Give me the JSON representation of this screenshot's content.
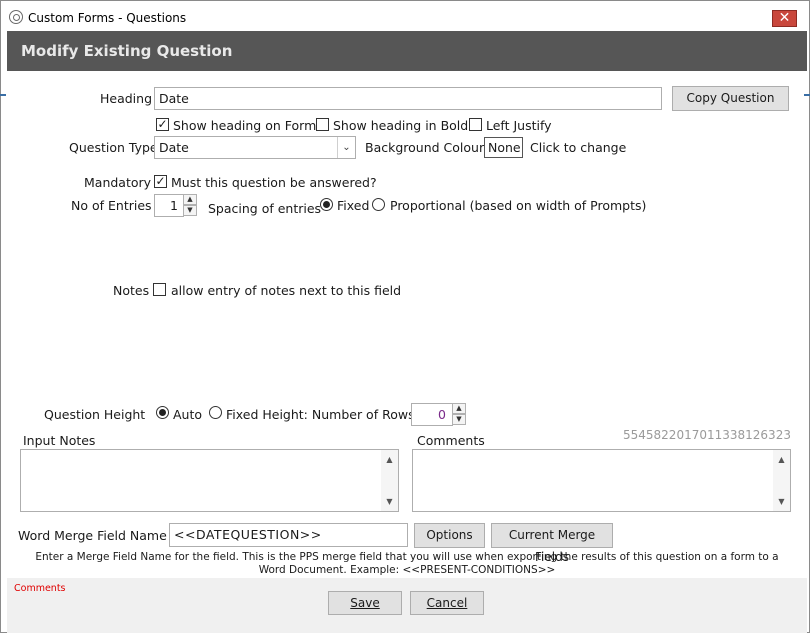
{
  "window": {
    "title": "Custom Forms - Questions",
    "close_glyph": "✕",
    "header": "Modify Existing Question"
  },
  "heading": {
    "label": "Heading",
    "value": "Date",
    "copy_button": "Copy Question",
    "show_on_form": {
      "label": "Show heading on Form",
      "checked": true
    },
    "show_bold": {
      "label": "Show heading in Bold",
      "checked": false
    },
    "left_justify": {
      "label": "Left Justify",
      "checked": false
    }
  },
  "question_type": {
    "label": "Question Type",
    "value": "Date",
    "bg_label": "Background Colour",
    "bg_value": "None",
    "bg_hint": "Click to change"
  },
  "mandatory": {
    "label": "Mandatory",
    "checkbox_label": "Must this question be answered?",
    "checked": true
  },
  "entries": {
    "label": "No of Entries",
    "value": "1",
    "spacing_label": "Spacing of entries",
    "fixed_label": "Fixed",
    "proportional_label": "Proportional (based on width of Prompts)",
    "selected": "Fixed"
  },
  "notes": {
    "label": "Notes",
    "checkbox_label": "allow entry of notes next to this field",
    "checked": false
  },
  "question_height": {
    "label": "Question Height",
    "auto_label": "Auto",
    "fixed_label": "Fixed Height: Number of Rows",
    "selected": "Auto",
    "rows_value": "0"
  },
  "input_notes": {
    "label": "Input Notes",
    "value": ""
  },
  "comments": {
    "label": "Comments",
    "value": "",
    "id_text": "5545822017011338126323"
  },
  "merge": {
    "label": "Word Merge Field Name",
    "value": "<<DATEQUESTION>>",
    "options_button": "Options",
    "current_button": "Current Merge Fields",
    "help": "Enter a Merge Field Name for the field. This is the PPS merge field that you will use when exporting the results of this question on a form to a Word Document. Example: <<PRESENT-CONDITIONS>>"
  },
  "footer": {
    "comments_link": "Comments",
    "save_label": "Save",
    "cancel_label": "Cancel"
  },
  "colors": {
    "header_band": "#565656",
    "close_button": "#c9473c",
    "comments_link": "#e00000",
    "id_text": "#9a9a9a",
    "fixed_rows_value": "#7a2a8a"
  },
  "icons": {
    "app": "app-circle-icon",
    "dropdown": "chevron-down-icon",
    "spin_up": "spin-up-icon",
    "spin_down": "spin-down-icon",
    "scroll_up": "scroll-up-icon",
    "scroll_down": "scroll-down-icon"
  }
}
